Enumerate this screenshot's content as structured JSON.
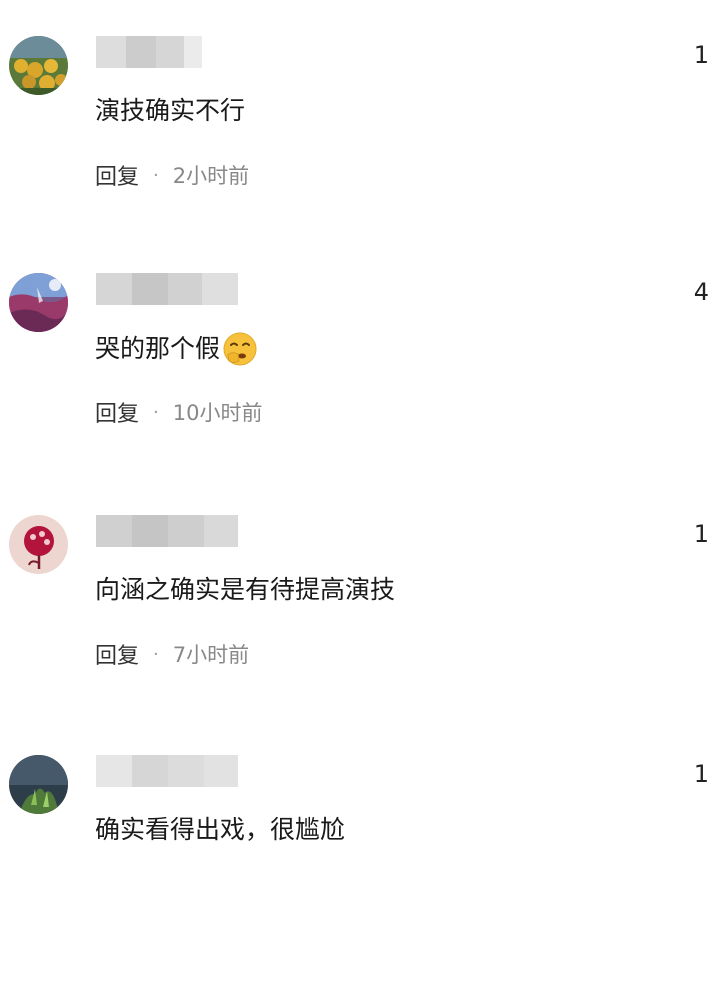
{
  "comments": [
    {
      "likes": "1",
      "text": "演技确实不行",
      "reply_label": "回复",
      "separator": "·",
      "time": "2小时前",
      "username_blurred": true
    },
    {
      "likes": "4",
      "text": "哭的那个假",
      "emoji": "shushing-face-emoji",
      "reply_label": "回复",
      "separator": "·",
      "time": "10小时前",
      "username_blurred": true
    },
    {
      "likes": "1",
      "text": "向涵之确实是有待提高演技",
      "reply_label": "回复",
      "separator": "·",
      "time": "7小时前",
      "username_blurred": true
    },
    {
      "likes": "1",
      "text": "确实看得出戏，很尴尬",
      "username_blurred": true
    }
  ]
}
